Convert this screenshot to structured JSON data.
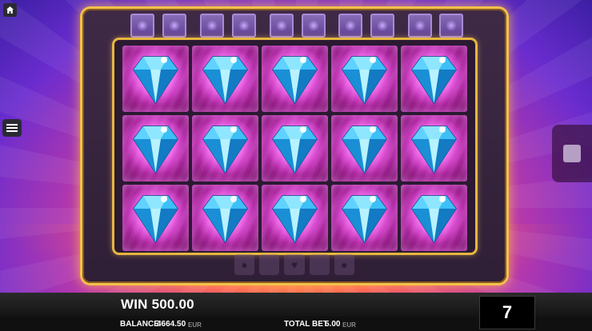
{
  "footer": {
    "win_label": "WIN",
    "win_value": "500.00",
    "balance_label": "BALANCE",
    "balance_value": "4664.50",
    "balance_currency": "EUR",
    "total_bet_label": "TOTAL BET",
    "total_bet_value": "5.00",
    "total_bet_currency": "EUR",
    "counter": "7"
  },
  "grid": {
    "rows": 3,
    "cols": 5,
    "symbols": [
      [
        "diamond",
        "diamond",
        "diamond",
        "diamond",
        "diamond"
      ],
      [
        "diamond",
        "diamond",
        "diamond",
        "diamond",
        "diamond"
      ],
      [
        "diamond",
        "diamond",
        "diamond",
        "diamond",
        "diamond"
      ]
    ]
  },
  "icons": {
    "home": "home-icon",
    "menu": "hamburger-menu-icon",
    "spin": "spin-stop-icon",
    "symbol": "diamond-icon"
  },
  "colors": {
    "gold": "#f2c24a",
    "cell_magenta": "#e043d6",
    "diamond_cyan": "#3fd0ff"
  }
}
